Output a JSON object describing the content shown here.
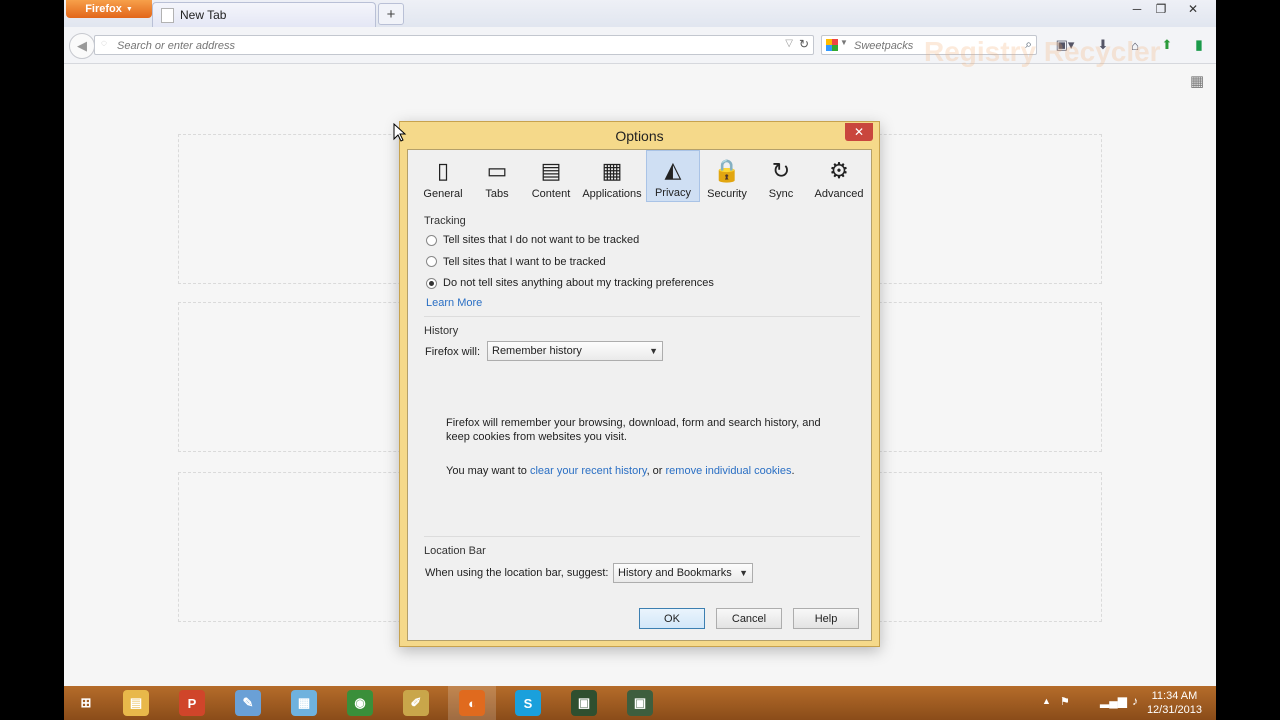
{
  "browser": {
    "menu_label": "Firefox",
    "menu_caret": "▼",
    "tab_title": "New Tab",
    "new_tab_glyph": "+",
    "window_controls": [
      "─",
      "❐",
      "✕"
    ],
    "url_placeholder": "Search or enter address",
    "search_engine": "Sweetpacks",
    "watermark_text": "Registry Recycler"
  },
  "taskbar": {
    "apps": [
      {
        "name": "start-icon",
        "glyph": "⊞",
        "color": "transparent"
      },
      {
        "name": "file-explorer-icon",
        "glyph": "▤",
        "color": "#e8b84a"
      },
      {
        "name": "powerpoint-icon",
        "glyph": "P",
        "color": "#d0452a"
      },
      {
        "name": "paint-icon",
        "glyph": "✎",
        "color": "#6aa0d6"
      },
      {
        "name": "notepad-icon",
        "glyph": "▦",
        "color": "#6fb2de"
      },
      {
        "name": "chrome-icon",
        "glyph": "◉",
        "color": "#3a8f3a"
      },
      {
        "name": "pen-app-icon",
        "glyph": "✐",
        "color": "#c9a64a"
      },
      {
        "name": "firefox-icon",
        "glyph": "◐",
        "color": "#e06a1e"
      },
      {
        "name": "skype-icon",
        "glyph": "S",
        "color": "#1aa0dc"
      },
      {
        "name": "terminal-icon",
        "glyph": "▣",
        "color": "#2f4f2f"
      },
      {
        "name": "terminal-alt-icon",
        "glyph": "▣",
        "color": "#3e5e3e"
      }
    ],
    "time": "11:34 AM",
    "date": "12/31/2013"
  },
  "dialog": {
    "title": "Options",
    "close_glyph": "✕",
    "panes": [
      {
        "label": "General",
        "icon": "switch-icon",
        "glyph": "▯",
        "selected": false
      },
      {
        "label": "Tabs",
        "icon": "tabs-icon",
        "glyph": "▭",
        "selected": false
      },
      {
        "label": "Content",
        "icon": "content-icon",
        "glyph": "▤",
        "selected": false
      },
      {
        "label": "Applications",
        "icon": "applications-icon",
        "glyph": "▦",
        "selected": false
      },
      {
        "label": "Privacy",
        "icon": "mask-icon",
        "glyph": "◭",
        "selected": true
      },
      {
        "label": "Security",
        "icon": "lock-icon",
        "glyph": "🔒",
        "selected": false
      },
      {
        "label": "Sync",
        "icon": "sync-icon",
        "glyph": "↻",
        "selected": false
      },
      {
        "label": "Advanced",
        "icon": "gear-icon",
        "glyph": "⚙",
        "selected": false
      }
    ],
    "tracking": {
      "heading": "Tracking",
      "options": [
        {
          "label": "Tell sites that I do not want to be tracked",
          "checked": false
        },
        {
          "label": "Tell sites that I want to be tracked",
          "checked": false
        },
        {
          "label": "Do not tell sites anything about my tracking preferences",
          "checked": true
        }
      ],
      "learn_more": "Learn More"
    },
    "history": {
      "heading": "History",
      "will_label": "Firefox will:",
      "will_value": "Remember history",
      "description": "Firefox will remember your browsing, download, form and search history, and keep cookies from websites you visit.",
      "may_want_prefix": "You may want to ",
      "clear_link": "clear your recent history",
      "or_text": ", or ",
      "remove_link": "remove individual cookies",
      "suffix": "."
    },
    "location_bar": {
      "heading": "Location Bar",
      "suggest_label": "When using the location bar, suggest:",
      "suggest_value": "History and Bookmarks"
    },
    "buttons": {
      "ok": "OK",
      "cancel": "Cancel",
      "help": "Help"
    }
  }
}
